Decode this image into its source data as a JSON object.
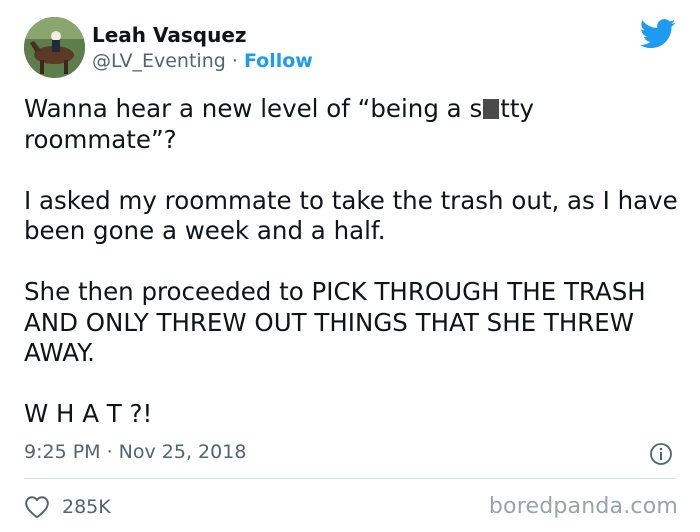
{
  "user": {
    "name": "Leah Vasquez",
    "handle": "@LV_Eventing",
    "separator": " · ",
    "follow_label": "Follow"
  },
  "tweet": {
    "line1_before": "Wanna hear a new level of “being a s",
    "line1_after": "tty roommate”?",
    "para2": "I asked my roommate to take the trash out, as I have been gone a week and a half.",
    "para3": "She then proceeded to PICK THROUGH THE TRASH AND ONLY THREW OUT THINGS THAT SHE THREW AWAY.",
    "para4": "W H A T ?!"
  },
  "meta": {
    "timestamp": "9:25 PM · Nov 25, 2018",
    "likes": "285K"
  },
  "watermark": "boredpanda.com",
  "icons": {
    "brand": "twitter-bird-icon",
    "info": "info-icon",
    "like": "heart-icon"
  },
  "colors": {
    "accent": "#1d9bf0",
    "text": "#0f1419",
    "muted": "#536471"
  }
}
